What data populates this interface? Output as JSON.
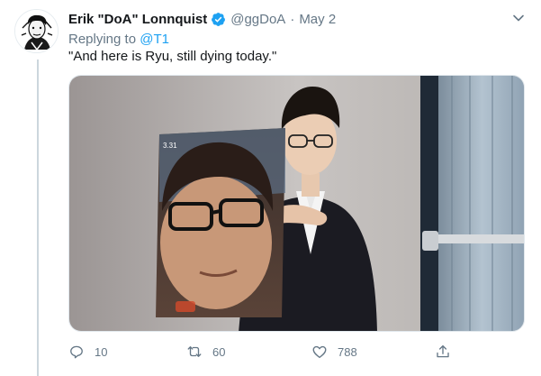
{
  "tweet": {
    "display_name": "Erik \"DoA\" Lonnquist",
    "handle": "@ggDoA",
    "separator": "·",
    "date": "May 2",
    "replying_prefix": "Replying to ",
    "replying_to": "@T1",
    "text": "\"And here is Ryu, still dying today.\"",
    "verified_icon": "verified-badge-icon",
    "more_icon": "chevron-down-icon",
    "media_overlay_text": "3.31"
  },
  "actions": {
    "reply_count": "10",
    "retweet_count": "60",
    "like_count": "788",
    "reply_icon": "reply-icon",
    "retweet_icon": "retweet-icon",
    "like_icon": "heart-icon",
    "share_icon": "share-icon"
  },
  "colors": {
    "accent": "#1da1f2",
    "secondary_text": "#657786",
    "primary_text": "#14171a",
    "border": "#e1e8ed"
  }
}
